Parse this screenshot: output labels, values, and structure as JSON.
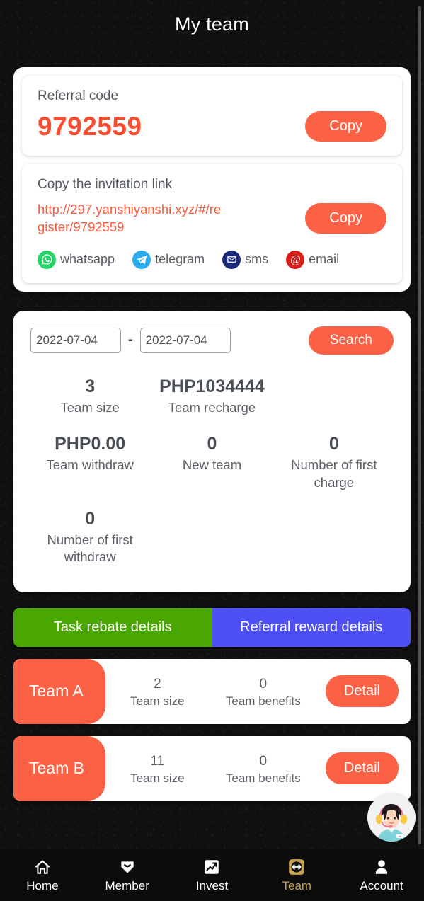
{
  "header": {
    "title": "My team"
  },
  "referral": {
    "label": "Referral code",
    "code": "9792559",
    "copy_label": "Copy"
  },
  "invitation": {
    "label": "Copy the invitation link",
    "url": "http://297.yanshiyanshi.xyz/#/register/9792559",
    "copy_label": "Copy",
    "socials": [
      {
        "name": "whatsapp",
        "icon": "whatsapp-icon",
        "color": "#25D366"
      },
      {
        "name": "telegram",
        "icon": "telegram-icon",
        "color": "#2AABEE"
      },
      {
        "name": "sms",
        "icon": "sms-icon",
        "color": "#1B2A78"
      },
      {
        "name": "email",
        "icon": "email-icon",
        "color": "#D91E18"
      }
    ]
  },
  "search": {
    "date_from": "2022-07-04",
    "date_to": "2022-07-04",
    "separator": "-",
    "button_label": "Search"
  },
  "stats": [
    {
      "value": "3",
      "label": "Team size"
    },
    {
      "value": "PHP1034444",
      "label": "Team recharge"
    },
    {
      "value": "",
      "label": ""
    },
    {
      "value": "PHP0.00",
      "label": "Team withdraw"
    },
    {
      "value": "0",
      "label": "New team"
    },
    {
      "value": "0",
      "label": "Number of first charge"
    },
    {
      "value": "0",
      "label": "Number of first withdraw"
    }
  ],
  "tabs": [
    {
      "label": "Task rebate details",
      "color": "#4aa600"
    },
    {
      "label": "Referral reward details",
      "color": "#4f4ff6"
    }
  ],
  "teams": [
    {
      "badge": "Team A",
      "size_value": "2",
      "size_label": "Team size",
      "benefits_value": "0",
      "benefits_label": "Team benefits",
      "detail_label": "Detail"
    },
    {
      "badge": "Team B",
      "size_value": "11",
      "size_label": "Team size",
      "benefits_value": "0",
      "benefits_label": "Team benefits",
      "detail_label": "Detail"
    }
  ],
  "bottom_nav": [
    {
      "label": "Home",
      "icon": "home-icon",
      "active": false
    },
    {
      "label": "Member",
      "icon": "heart-icon",
      "active": false
    },
    {
      "label": "Invest",
      "icon": "chart-icon",
      "active": false
    },
    {
      "label": "Team",
      "icon": "team-icon",
      "active": true
    },
    {
      "label": "Account",
      "icon": "person-icon",
      "active": false
    }
  ],
  "colors": {
    "accent": "#fb6144",
    "accent_text": "#fb4e31",
    "tab_green": "#4aa600",
    "tab_blue": "#4f4ff6",
    "nav_active": "#c6a34f",
    "background": "#101010"
  }
}
